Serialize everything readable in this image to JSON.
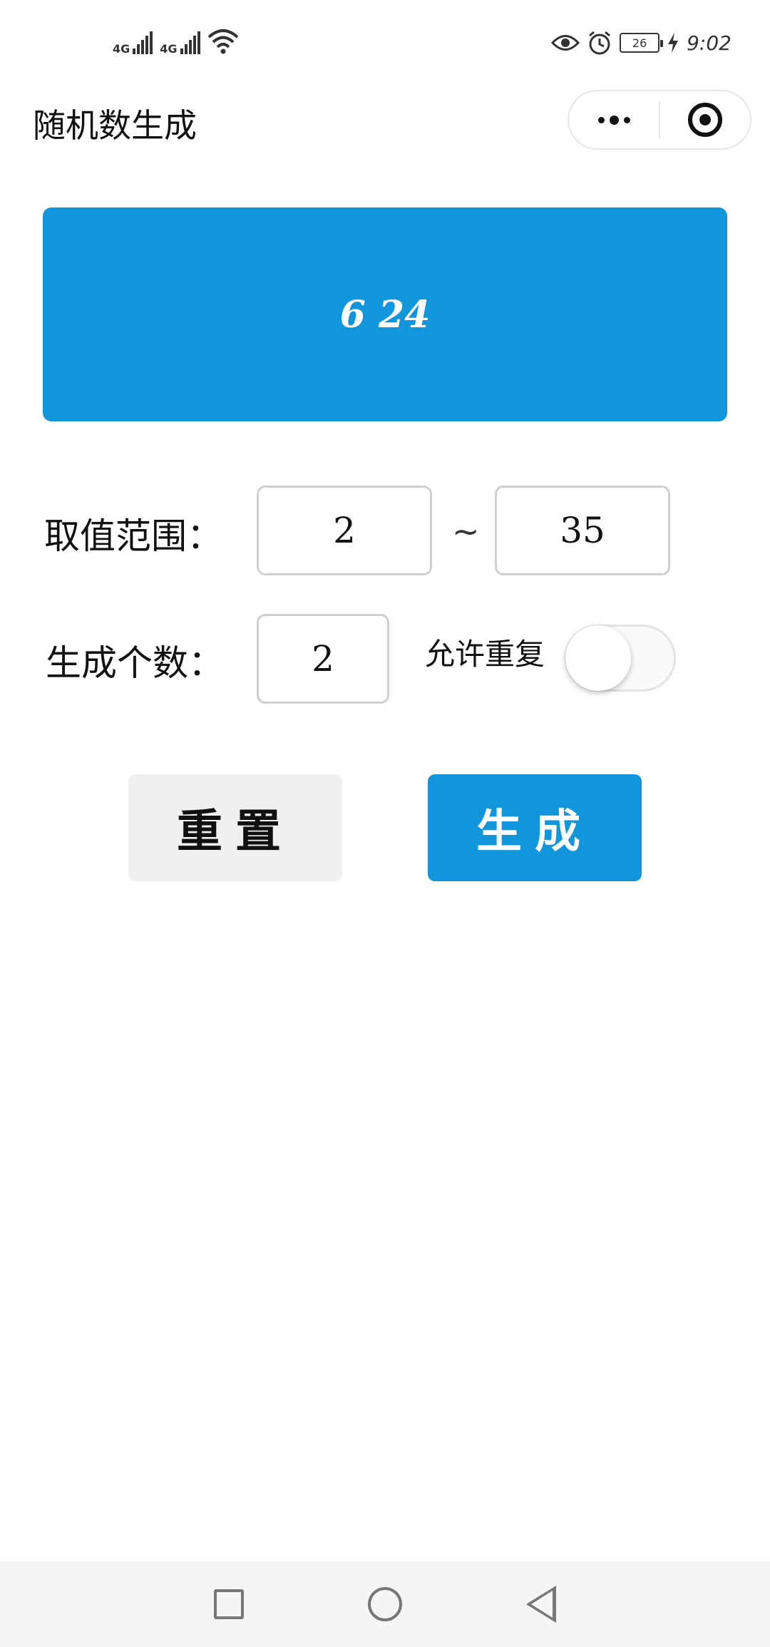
{
  "status_bar": {
    "signal1_label": "4G",
    "signal2_label": "4G",
    "battery_level": "26",
    "time": "9:02"
  },
  "nav": {
    "title": "随机数生成"
  },
  "result": {
    "value": "6 24"
  },
  "range": {
    "label": "取值范围：",
    "min": "2",
    "separator": "~",
    "max": "35"
  },
  "count": {
    "label": "生成个数：",
    "value": "2"
  },
  "allow_repeat": {
    "label": "允许重复",
    "enabled": false
  },
  "buttons": {
    "reset_label": "重置",
    "generate_label": "生成"
  },
  "colors": {
    "primary": "#1296db",
    "secondary_button": "#f0f0f0"
  }
}
